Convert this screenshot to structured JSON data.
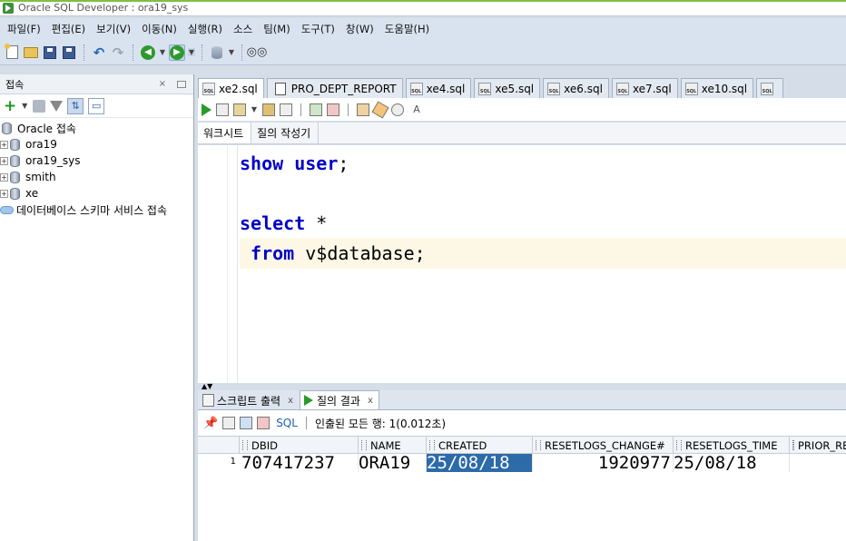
{
  "window": {
    "title": "Oracle SQL Developer : ora19_sys"
  },
  "menu": [
    "파일(F)",
    "편집(E)",
    "보기(V)",
    "이동(N)",
    "실행(R)",
    "소스",
    "팀(M)",
    "도구(T)",
    "창(W)",
    "도움말(H)"
  ],
  "connections_panel": {
    "title": "접속",
    "root_label": "Oracle 접속",
    "items": [
      "ora19",
      "ora19_sys",
      "smith",
      "xe"
    ],
    "cloud_label": "데이터베이스 스키마 서비스 접속"
  },
  "editor_tabs": [
    "xe2.sql",
    "PRO_DEPT_REPORT",
    "xe4.sql",
    "xe5.sql",
    "xe6.sql",
    "xe7.sql",
    "xe10.sql"
  ],
  "worksheet_subtabs": [
    "워크시트",
    "질의 작성기"
  ],
  "code": {
    "line1_kw1": "show",
    "line1_kw2": "user",
    "line1_end": ";",
    "line2_kw": "select",
    "line2_rest": " *",
    "line3_kw": "from",
    "line3_rest": " v$database;"
  },
  "bottom_tabs": {
    "script_output": "스크립트 출력",
    "query_result": "질의 결과",
    "close": "x"
  },
  "results_toolbar": {
    "sql_label": "SQL",
    "status": "인출된 모든 행: 1(0.012초)"
  },
  "grid": {
    "columns": [
      "DBID",
      "NAME",
      "CREATED",
      "RESETLOGS_CHANGE#",
      "RESETLOGS_TIME",
      "PRIOR_RESETLOGS_CHANGE#"
    ],
    "rows": [
      {
        "rownum": "1",
        "DBID": "707417237",
        "NAME": "ORA19",
        "CREATED": "25/08/18",
        "RESETLOGS_CHANGE": "1920977",
        "RESETLOGS_TIME": "25/08/18"
      }
    ]
  }
}
